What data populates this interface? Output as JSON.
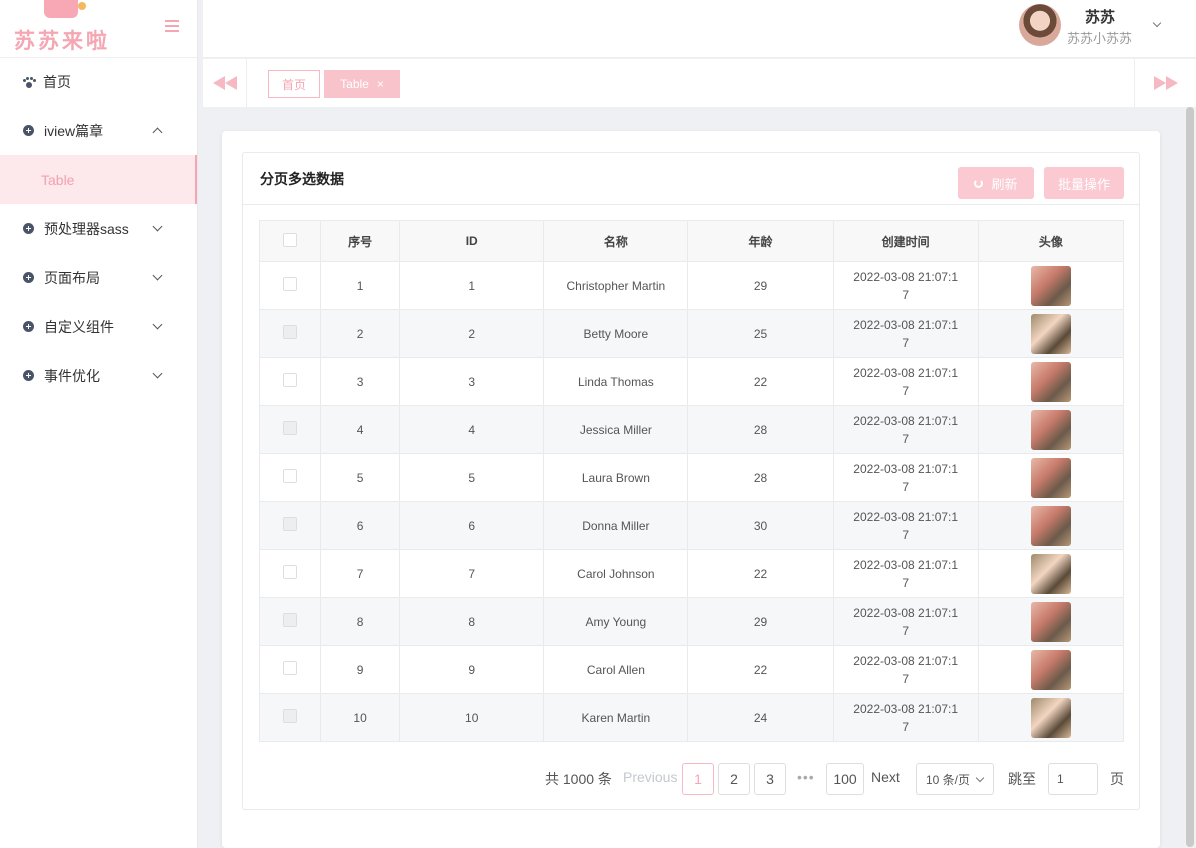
{
  "logo": {
    "text": "苏苏来啦"
  },
  "sidebar": {
    "items": [
      {
        "label": "首页",
        "icon": "paw-icon"
      },
      {
        "label": "iview篇章",
        "icon": "circle-plus-icon",
        "expanded": true,
        "children": [
          {
            "label": "Table",
            "active": true
          }
        ]
      },
      {
        "label": "预处理器sass",
        "icon": "circle-plus-icon"
      },
      {
        "label": "页面布局",
        "icon": "circle-plus-icon"
      },
      {
        "label": "自定义组件",
        "icon": "circle-plus-icon"
      },
      {
        "label": "事件优化",
        "icon": "circle-plus-icon"
      }
    ]
  },
  "header": {
    "user_name": "苏苏",
    "user_sub": "苏苏小苏苏"
  },
  "tabs": {
    "home": "首页",
    "active": "Table",
    "close": "×"
  },
  "panel": {
    "title": "分页多选数据",
    "refresh_label": "刷新",
    "batch_label": "批量操作"
  },
  "table": {
    "headers": [
      "序号",
      "ID",
      "名称",
      "年龄",
      "创建时间",
      "头像"
    ],
    "rows": [
      {
        "no": "1",
        "id": "1",
        "name": "Christopher Martin",
        "age": "29",
        "time1": "2022-03-08 21:07:1",
        "time2": "7"
      },
      {
        "no": "2",
        "id": "2",
        "name": "Betty Moore",
        "age": "25",
        "time1": "2022-03-08 21:07:1",
        "time2": "7"
      },
      {
        "no": "3",
        "id": "3",
        "name": "Linda Thomas",
        "age": "22",
        "time1": "2022-03-08 21:07:1",
        "time2": "7"
      },
      {
        "no": "4",
        "id": "4",
        "name": "Jessica Miller",
        "age": "28",
        "time1": "2022-03-08 21:07:1",
        "time2": "7"
      },
      {
        "no": "5",
        "id": "5",
        "name": "Laura Brown",
        "age": "28",
        "time1": "2022-03-08 21:07:1",
        "time2": "7"
      },
      {
        "no": "6",
        "id": "6",
        "name": "Donna Miller",
        "age": "30",
        "time1": "2022-03-08 21:07:1",
        "time2": "7"
      },
      {
        "no": "7",
        "id": "7",
        "name": "Carol Johnson",
        "age": "22",
        "time1": "2022-03-08 21:07:1",
        "time2": "7"
      },
      {
        "no": "8",
        "id": "8",
        "name": "Amy Young",
        "age": "29",
        "time1": "2022-03-08 21:07:1",
        "time2": "7"
      },
      {
        "no": "9",
        "id": "9",
        "name": "Carol Allen",
        "age": "22",
        "time1": "2022-03-08 21:07:1",
        "time2": "7"
      },
      {
        "no": "10",
        "id": "10",
        "name": "Karen Martin",
        "age": "24",
        "time1": "2022-03-08 21:07:1",
        "time2": "7"
      }
    ]
  },
  "pager": {
    "total": "共 1000 条",
    "prev": "Previous",
    "pages": [
      "1",
      "2",
      "3"
    ],
    "dots": "•••",
    "last": "100",
    "next": "Next",
    "size": "10 条/页",
    "jump": "跳至",
    "jump_value": "1",
    "page_unit": "页"
  },
  "colors": {
    "accent": "#f4a7b3",
    "accent_light": "#fac9d1",
    "active_bg": "#fde9ec"
  }
}
